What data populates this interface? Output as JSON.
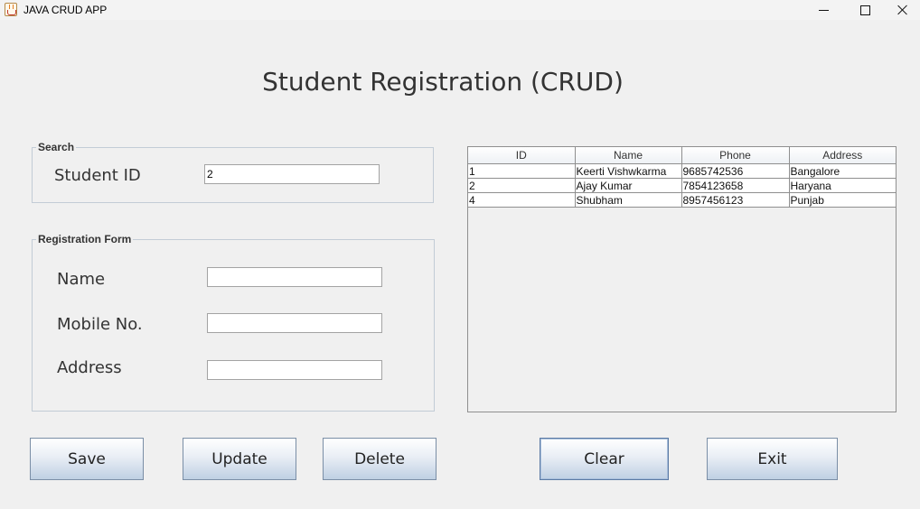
{
  "window": {
    "title": "JAVA CRUD APP",
    "icon": "java-cup-icon",
    "controls": [
      "minimize-icon",
      "maximize-icon",
      "close-icon"
    ]
  },
  "heading": "Student Registration (CRUD)",
  "search": {
    "legend": "Search",
    "student_id_label": "Student ID",
    "student_id_value": "2"
  },
  "registration": {
    "legend": "Registration Form",
    "name_label": "Name",
    "name_value": "",
    "mobile_label": "Mobile No.",
    "mobile_value": "",
    "address_label": "Address",
    "address_value": ""
  },
  "table": {
    "columns": [
      "ID",
      "Name",
      "Phone",
      "Address"
    ],
    "rows": [
      [
        "1",
        "Keerti Vishwkarma",
        "9685742536",
        "Bangalore"
      ],
      [
        "2",
        "Ajay Kumar",
        "7854123658",
        "Haryana"
      ],
      [
        "4",
        "Shubham",
        "8957456123",
        "Punjab"
      ]
    ]
  },
  "buttons": {
    "save": "Save",
    "update": "Update",
    "delete": "Delete",
    "clear": "Clear",
    "exit": "Exit"
  }
}
